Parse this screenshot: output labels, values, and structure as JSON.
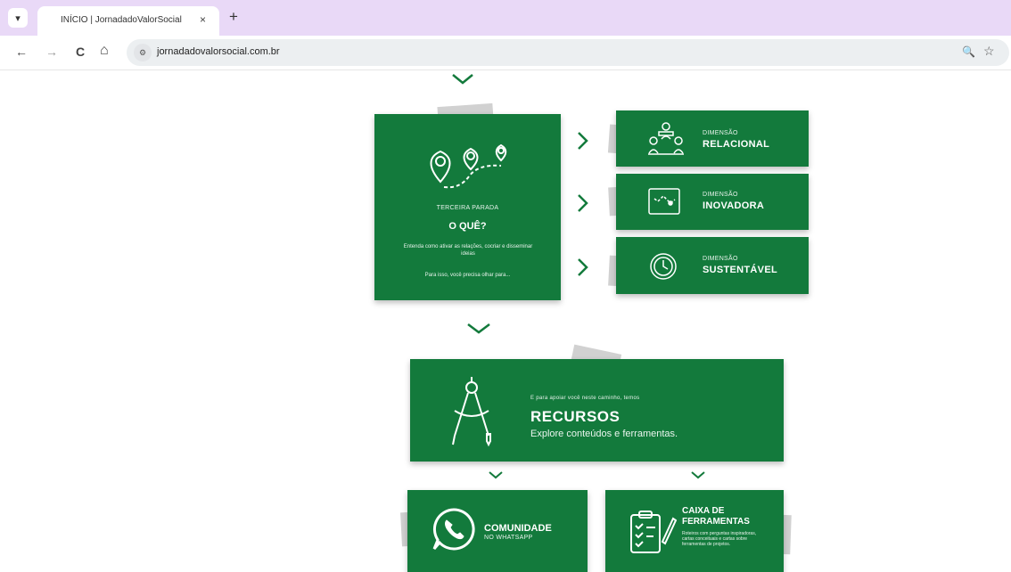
{
  "browser": {
    "tab_menu_icon": "▾",
    "tab_title": "INÍCIO | JornadadoValorSocial",
    "tab_close": "×",
    "new_tab": "+",
    "back": "←",
    "forward": "→",
    "reload": "C",
    "home": "⌂",
    "url": "jornadadovalorsocial.com.br",
    "zoom_icon": "🔍",
    "star_icon": "☆"
  },
  "stop3": {
    "label": "TERCEIRA PARADA",
    "title": "O QUÊ?",
    "desc": "Entenda como ativar as relações, cocriar e disseminar ideias",
    "note": "Para isso, você precisa olhar para..."
  },
  "dimensions": [
    {
      "small": "DIMENSÃO",
      "big": "RELACIONAL",
      "icon": "people-network-icon"
    },
    {
      "small": "DIMENSÃO",
      "big": "INOVADORA",
      "icon": "map-route-icon"
    },
    {
      "small": "DIMENSÃO",
      "big": "SUSTENTÁVEL",
      "icon": "clock-icon"
    }
  ],
  "resources": {
    "intro": "E para apoiar você neste caminho, temos",
    "title": "RECURSOS",
    "subtitle": "Explore conteúdos e ferramentas."
  },
  "community": {
    "title": "COMUNIDADE",
    "subtitle": "NO WHATSAPP"
  },
  "toolbox": {
    "title_line1": "CAIXA DE",
    "title_line2": "FERRAMENTAS",
    "desc": "Roteiros com perguntas inspiradoras, cartas conceituais e cartas sobre ferramentas de projetos."
  },
  "colors": {
    "green": "#137a3c",
    "tab_bar": "#e9d9f7"
  }
}
